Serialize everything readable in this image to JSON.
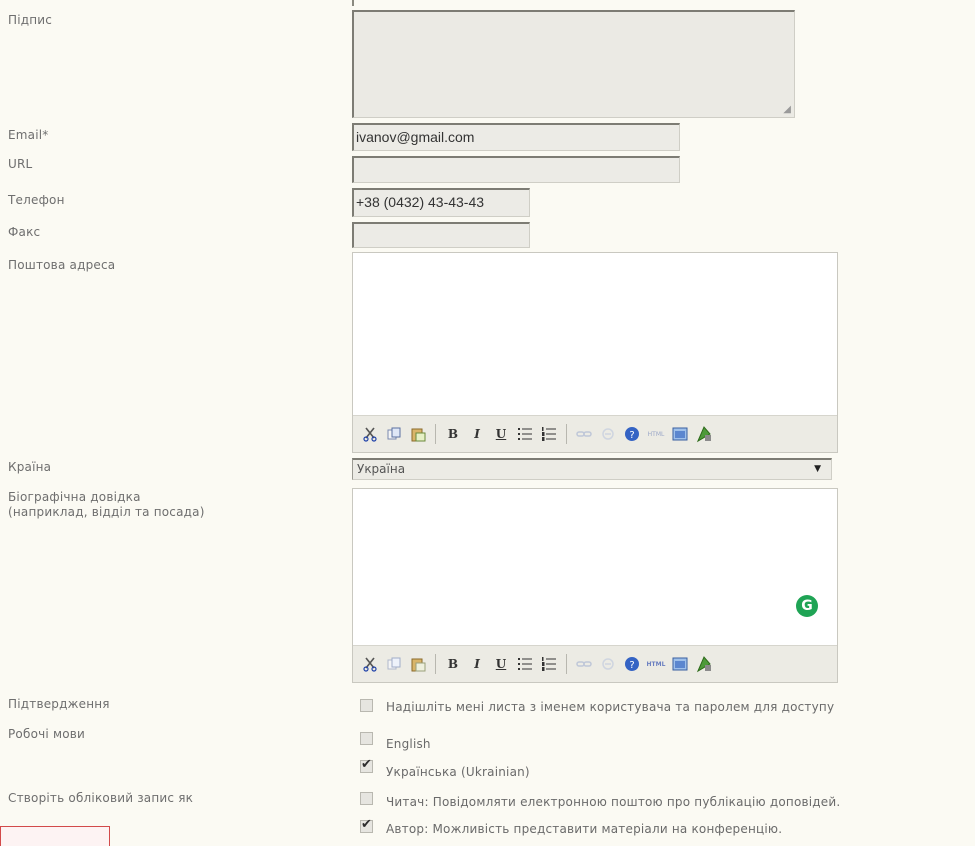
{
  "labels": {
    "signature": "Підпис",
    "email": "Email*",
    "url": "URL",
    "phone": "Телефон",
    "fax": "Факс",
    "postal": "Поштова адреса",
    "country": "Країна",
    "bio_line1": "Біографічна довідка",
    "bio_line2": "(наприклад, відділ та посада)",
    "confirmation": "Підтвердження",
    "languages": "Робочі мови",
    "create_account": "Створіть обліковий запис як"
  },
  "fields": {
    "email_value": "ivanov@gmail.com",
    "url_value": "",
    "phone_value": "+38 (0432) 43-43-43",
    "fax_value": "",
    "country_value": "Україна"
  },
  "checkboxes": {
    "send_email": {
      "label": "Надішліть мені листа з іменем користувача та паролем для доступу",
      "checked": false
    },
    "english": {
      "label": "English",
      "checked": false
    },
    "ukrainian": {
      "label": "Українська (Ukrainian)",
      "checked": true
    },
    "reader": {
      "label": "Читач: Повідомляти електронною поштою про публікацію доповідей.",
      "checked": false
    },
    "author": {
      "label": "Автор: Можливість представити матеріали на конференцію.",
      "checked": true
    }
  },
  "toolbar": {
    "icons": [
      "cut-icon",
      "copy-icon",
      "paste-icon",
      "bold-icon",
      "italic-icon",
      "underline-icon",
      "bullet-list-icon",
      "numbered-list-icon",
      "link-icon",
      "unlink-icon",
      "help-icon",
      "html-icon",
      "fullscreen-icon",
      "image-icon"
    ],
    "bold": "B",
    "italic": "I",
    "underline": "U",
    "html": "HTML"
  },
  "colors": {
    "background": "#fbfaf3",
    "field": "#ecebe6",
    "grammarly": "#1fa455"
  }
}
